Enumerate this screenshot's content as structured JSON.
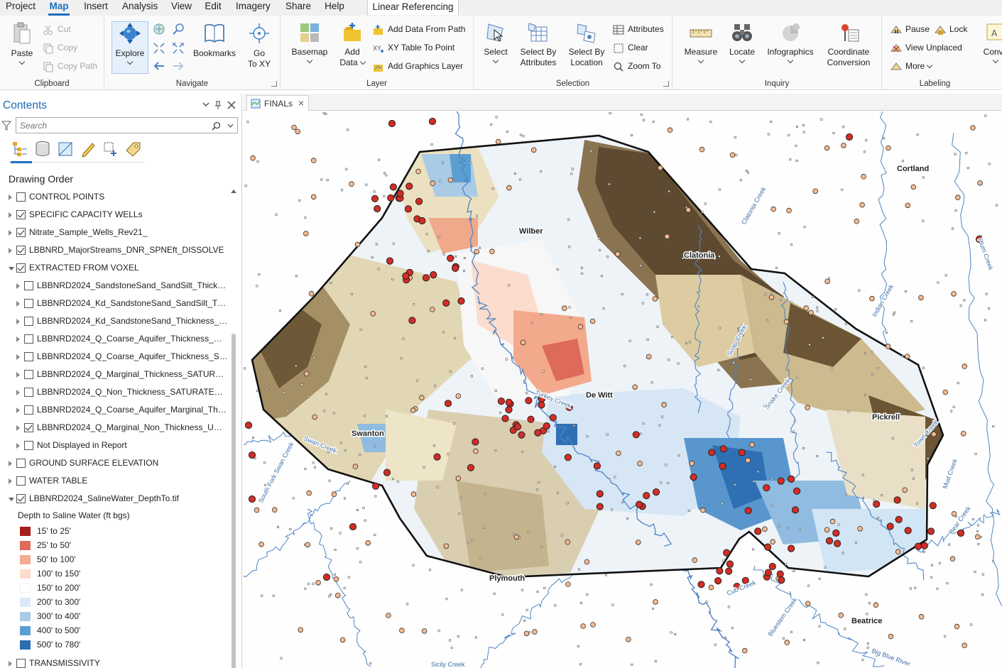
{
  "menubar": {
    "tabs": [
      "Project",
      "Map",
      "Insert",
      "Analysis",
      "View",
      "Edit",
      "Imagery",
      "Share",
      "Help"
    ],
    "active_tab": "Map",
    "context_tab": "Linear Referencing"
  },
  "ribbon": {
    "clipboard": {
      "label": "Clipboard",
      "paste": "Paste",
      "cut": "Cut",
      "copy": "Copy",
      "copy_path": "Copy Path"
    },
    "navigate": {
      "label": "Navigate",
      "explore": "Explore",
      "bookmarks": "Bookmarks",
      "goto": "Go\nTo XY",
      "goto_line1": "Go",
      "goto_line2": "To XY"
    },
    "layer": {
      "label": "Layer",
      "basemap": "Basemap",
      "add_data_1": "Add",
      "add_data_2": "Data",
      "add_from_path": "Add Data From Path",
      "xy_table": "XY Table To Point",
      "add_graphics": "Add Graphics Layer"
    },
    "selection": {
      "label": "Selection",
      "select": "Select",
      "by_attr_1": "Select By",
      "by_attr_2": "Attributes",
      "by_loc_1": "Select By",
      "by_loc_2": "Location",
      "attributes": "Attributes",
      "clear": "Clear",
      "zoom_to": "Zoom To"
    },
    "inquiry": {
      "label": "Inquiry",
      "measure": "Measure",
      "locate": "Locate",
      "infographics": "Infographics",
      "coord_1": "Coordinate",
      "coord_2": "Conversion"
    },
    "labeling": {
      "label": "Labeling",
      "pause": "Pause",
      "lock": "Lock",
      "view_unplaced": "View Unplaced",
      "more": "More",
      "convert": "Conve"
    }
  },
  "contents": {
    "title": "Contents",
    "search_placeholder": "Search",
    "drawing_order": "Drawing Order",
    "layers": [
      {
        "label": "CONTROL POINTS",
        "checked": false,
        "expanded": false,
        "level": 0
      },
      {
        "label": "SPECIFIC CAPACITY WELLs",
        "checked": true,
        "expanded": false,
        "level": 0
      },
      {
        "label": "Nitrate_Sample_Wells_Rev21_",
        "checked": true,
        "expanded": false,
        "level": 0
      },
      {
        "label": "LBBNRD_MajorStreams_DNR_SPNEft_DISSOLVE",
        "checked": true,
        "expanded": false,
        "level": 0
      },
      {
        "label": "EXTRACTED FROM VOXEL",
        "checked": true,
        "expanded": true,
        "level": 0
      },
      {
        "label": "LBBNRD2024_SandstoneSand_SandSilt_Thicknes...",
        "checked": false,
        "expanded": false,
        "level": 1
      },
      {
        "label": "LBBNRD2024_Kd_SandstoneSand_SandSilt_Thick...",
        "checked": false,
        "expanded": false,
        "level": 1
      },
      {
        "label": "LBBNRD2024_Kd_SandstoneSand_Thickness_SAT...",
        "checked": false,
        "expanded": false,
        "level": 1
      },
      {
        "label": "LBBNRD2024_Q_Coarse_Aquifer_Thickness_WH...",
        "checked": false,
        "expanded": false,
        "level": 1
      },
      {
        "label": "LBBNRD2024_Q_Coarse_Aquifer_Thickness_SAT...",
        "checked": false,
        "expanded": false,
        "level": 1
      },
      {
        "label": "LBBNRD2024_Q_Marginal_Thickness_SATURATE...",
        "checked": false,
        "expanded": false,
        "level": 1
      },
      {
        "label": "LBBNRD2024_Q_Non_Thickness_SATURATED.tif",
        "checked": false,
        "expanded": false,
        "level": 1
      },
      {
        "label": "LBBNRD2024_Q_Coarse_Aquifer_Marginal_Thick...",
        "checked": false,
        "expanded": false,
        "level": 1
      },
      {
        "label": "LBBNRD2024_Q_Marginal_Non_Thickness_UNSA...",
        "checked": true,
        "expanded": false,
        "level": 1
      },
      {
        "label": "Not Displayed in Report",
        "checked": false,
        "expanded": false,
        "level": 1
      },
      {
        "label": "GROUND SURFACE ELEVATION",
        "checked": false,
        "expanded": false,
        "level": 0
      },
      {
        "label": "WATER TABLE",
        "checked": false,
        "expanded": false,
        "level": 0
      },
      {
        "label": "LBBNRD2024_SalineWater_DepthTo.tif",
        "checked": true,
        "expanded": true,
        "level": 0
      }
    ],
    "legend_title": "Depth to Saline Water (ft bgs)",
    "legend": [
      {
        "label": "15' to 25'",
        "color": "#a81d1d"
      },
      {
        "label": "25' to 50'",
        "color": "#de6a5a"
      },
      {
        "label": "50' to 100'",
        "color": "#f4ad92"
      },
      {
        "label": "100' to 150'",
        "color": "#fbdccd"
      },
      {
        "label": "150' to 200'",
        "color": "#ffffff"
      },
      {
        "label": "200' to 300'",
        "color": "#dbe9f6"
      },
      {
        "label": "300' to 400'",
        "color": "#a9cbe6"
      },
      {
        "label": "400' to 500'",
        "color": "#5b9fd0"
      },
      {
        "label": "500' to 780'",
        "color": "#2c6db1"
      }
    ],
    "last_layer": {
      "label": "TRANSMISSIVITY",
      "checked": false
    }
  },
  "map": {
    "tab_label": "FINALs",
    "places": [
      "Cortland",
      "Wilber",
      "Clatonia",
      "De Witt",
      "Pickrell",
      "Swanton",
      "Plymouth",
      "Beatrice"
    ],
    "streams": [
      "Turkey Creek",
      "Swan Creek",
      "South Fork Swan Creek",
      "Cub Creek",
      "Soap Creek",
      "Snake Creek",
      "Indian Creek",
      "Clatonia Creek",
      "Town Creek",
      "Mud Creek",
      "Big Blue River",
      "Bear Creek",
      "Plum Creek",
      "Bluestem Creek",
      "Sicily Creek",
      "Cub Creek"
    ],
    "colors": {
      "boundary": "#111111",
      "stream": "#4f84c4",
      "well_red": "#d42d25",
      "well_orange": "#f6b98d"
    }
  }
}
